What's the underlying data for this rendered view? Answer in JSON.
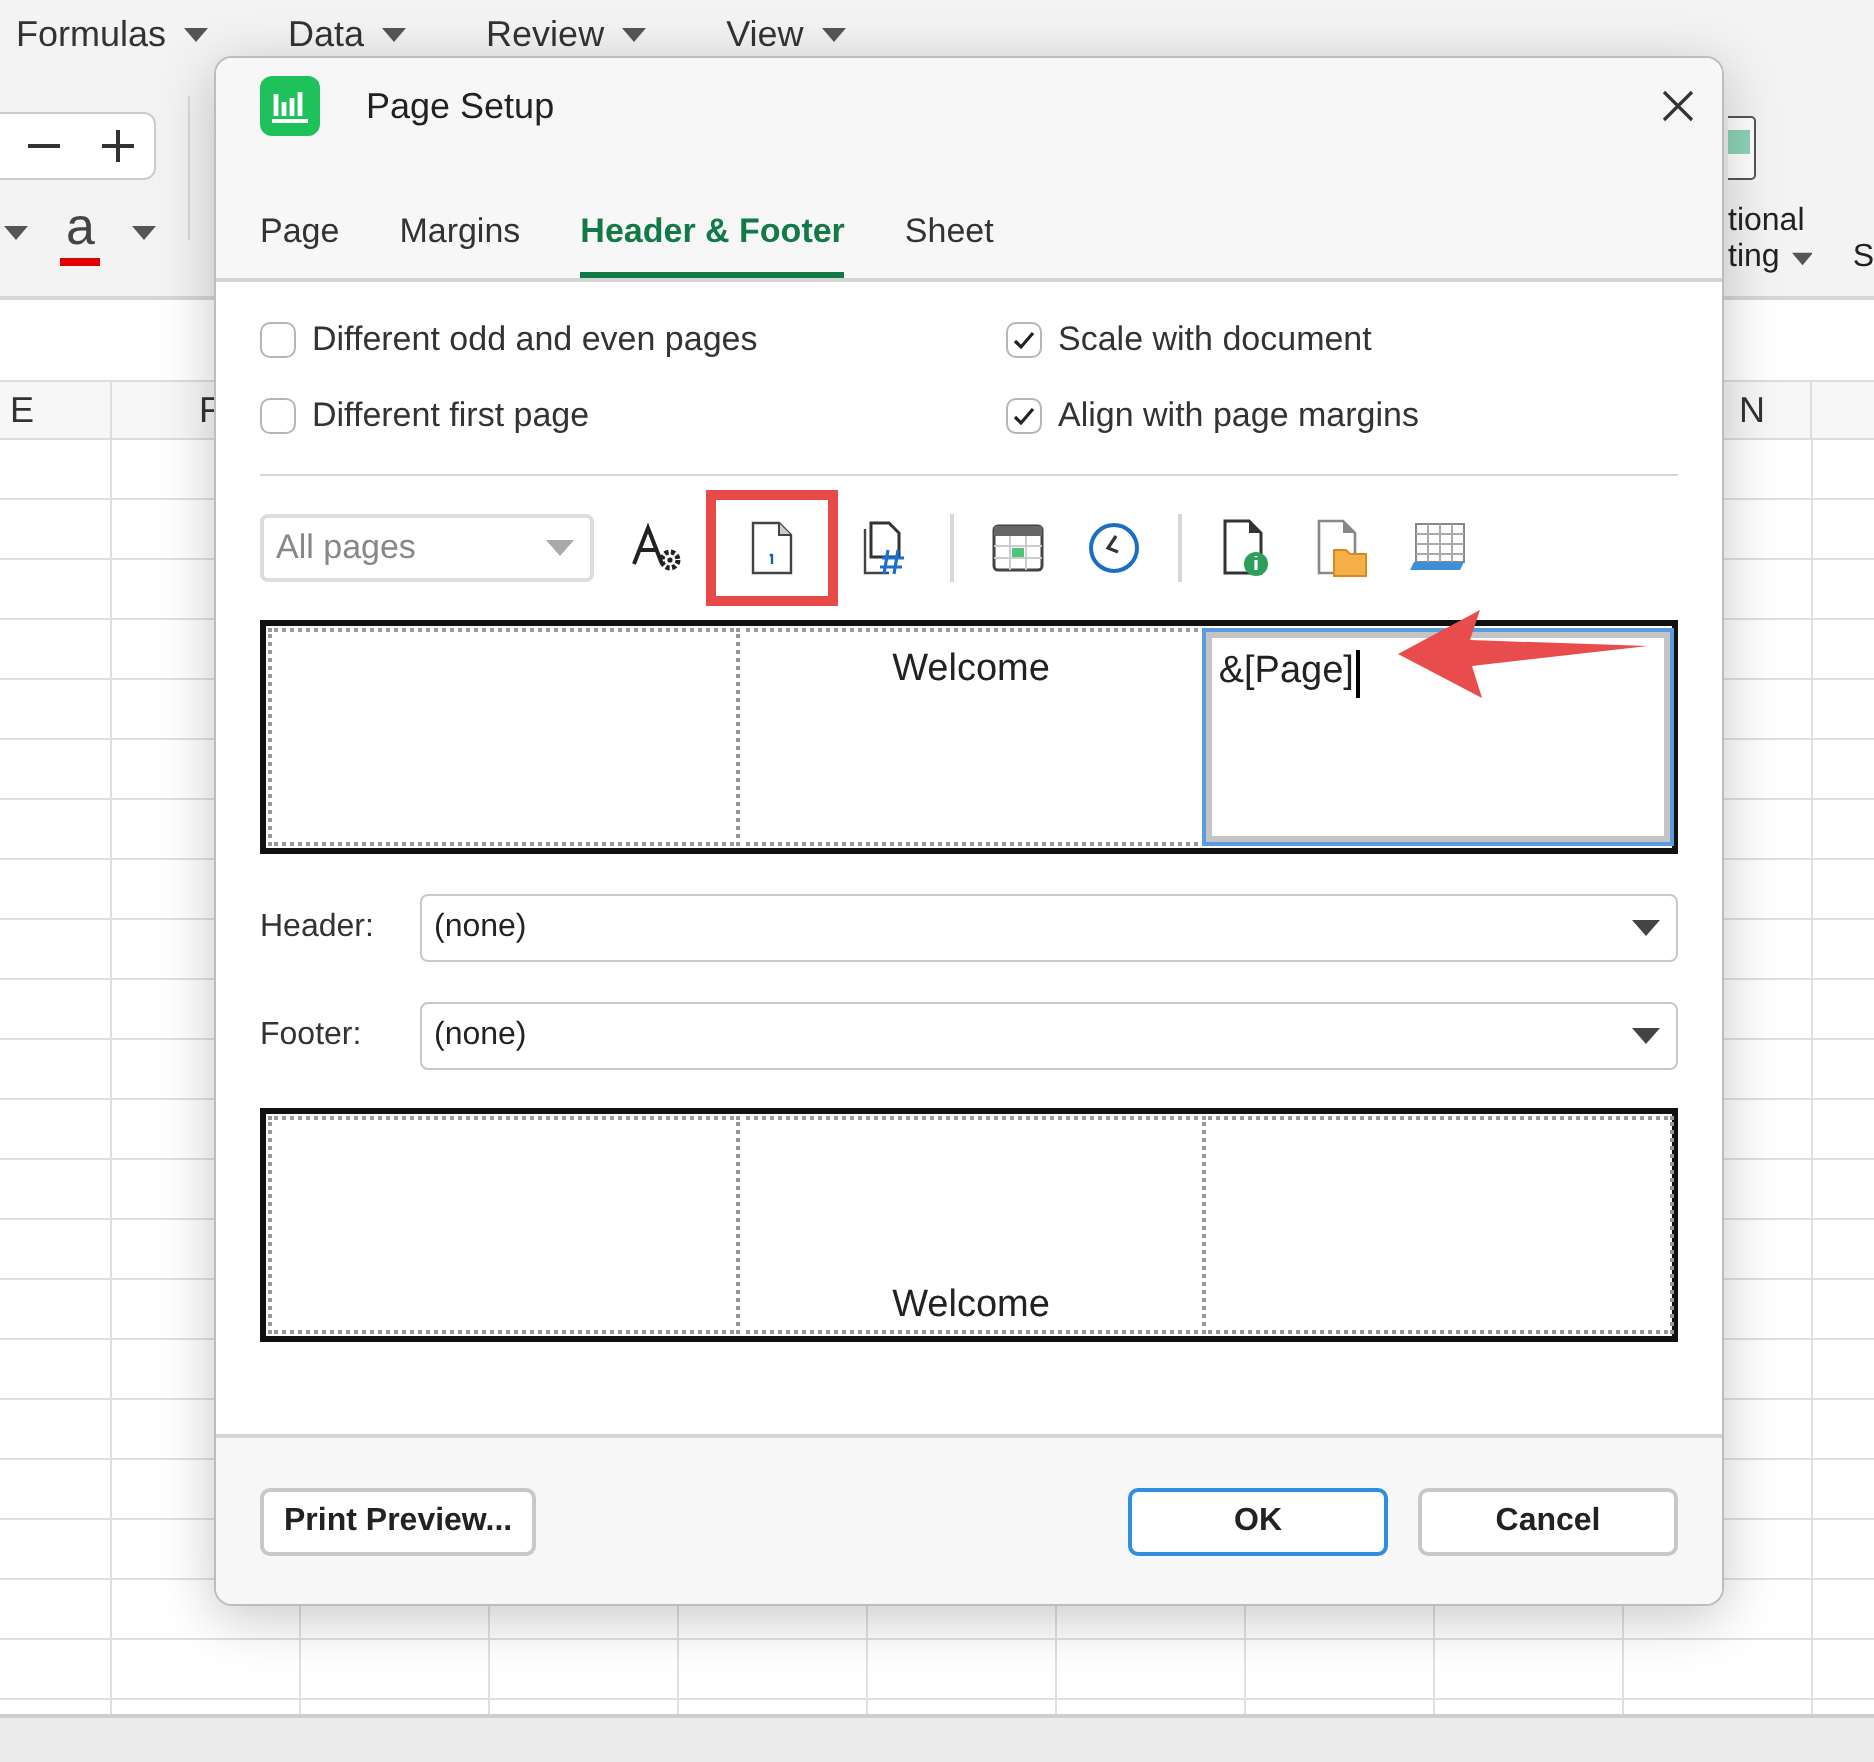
{
  "app_menu": [
    {
      "label": "Formulas"
    },
    {
      "label": "Data"
    },
    {
      "label": "Review"
    },
    {
      "label": "View"
    }
  ],
  "ribbon": {
    "font_color_letter": "a",
    "cut_labels": [
      "tional",
      "ting"
    ],
    "next_label": "S"
  },
  "column_headers": [
    "E",
    "F",
    "N"
  ],
  "dialog": {
    "title": "Page Setup",
    "tabs": [
      {
        "label": "Page",
        "selected": false
      },
      {
        "label": "Margins",
        "selected": false
      },
      {
        "label": "Header & Footer",
        "selected": true
      },
      {
        "label": "Sheet",
        "selected": false
      }
    ],
    "options": [
      {
        "label": "Different odd and even pages",
        "checked": false
      },
      {
        "label": "Scale with document",
        "checked": true
      },
      {
        "label": "Different first page",
        "checked": false
      },
      {
        "label": "Align with page margins",
        "checked": true
      }
    ],
    "page_scope": {
      "value": "All pages",
      "disabled": true
    },
    "tool_groups": [
      [
        {
          "kind": "format-text",
          "highlighted": false
        },
        {
          "kind": "page-number",
          "highlighted": true
        },
        {
          "kind": "page-count",
          "highlighted": false
        }
      ],
      [
        {
          "kind": "date",
          "highlighted": false
        },
        {
          "kind": "time",
          "highlighted": false
        }
      ],
      [
        {
          "kind": "file-path",
          "highlighted": false
        },
        {
          "kind": "file-name",
          "highlighted": false
        },
        {
          "kind": "sheet-name",
          "highlighted": false
        }
      ]
    ],
    "header_preview": {
      "sections": [
        {
          "selected": false
        },
        {
          "text": "Welcome",
          "selected": false
        },
        {
          "text": "&[Page]",
          "selected": true
        }
      ]
    },
    "header": {
      "label": "Header:",
      "value": "(none)"
    },
    "footer": {
      "label": "Footer:",
      "value": "(none)"
    },
    "footer_preview": {
      "sections": [
        {
          "selected": false
        },
        {
          "text": "Welcome",
          "selected": false
        },
        {
          "selected": false
        }
      ]
    },
    "buttons": [
      {
        "label": "Print Preview...",
        "default": false
      },
      {
        "label": "OK",
        "default": true
      },
      {
        "label": "Cancel",
        "default": false
      }
    ]
  }
}
